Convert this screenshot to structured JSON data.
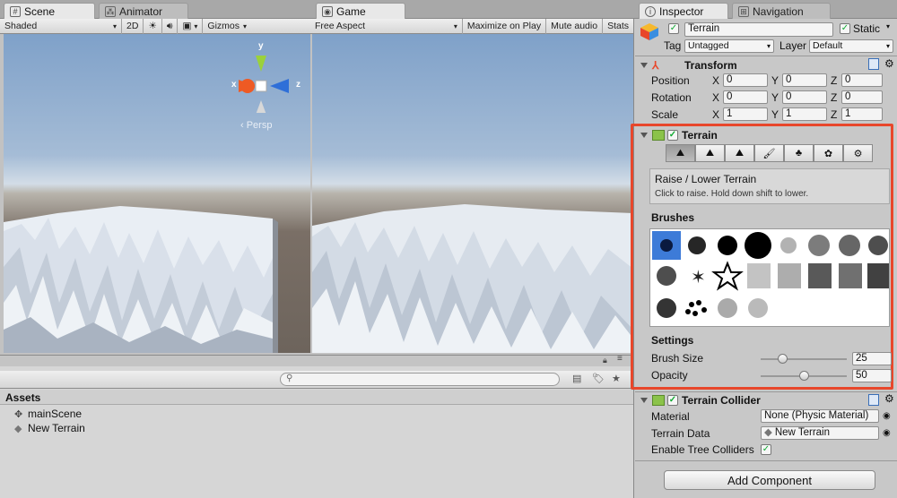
{
  "scene_panel": {
    "tabs": [
      {
        "label": "Scene",
        "icon": "hash-icon"
      },
      {
        "label": "Animator",
        "icon": "animator-icon"
      }
    ],
    "toolbar": {
      "shading": "Shaded",
      "mode_2d": "2D",
      "gizmos": "Gizmos"
    },
    "gizmo": {
      "y": "y",
      "x": "x",
      "z": "z",
      "projection": "‹ Persp"
    }
  },
  "game_panel": {
    "tab": "Game",
    "toolbar": {
      "aspect": "Free Aspect",
      "maximize": "Maximize on Play",
      "mute": "Mute audio",
      "stats": "Stats"
    }
  },
  "project_panel": {
    "assets_header": "Assets",
    "items": [
      {
        "label": "mainScene",
        "icon": "unity-scene-icon"
      },
      {
        "label": "New Terrain",
        "icon": "terrain-asset-icon"
      }
    ]
  },
  "inspector": {
    "tabs": [
      {
        "label": "Inspector",
        "icon": "info-icon"
      },
      {
        "label": "Navigation",
        "icon": "navigation-icon"
      }
    ],
    "object_name": "Terrain",
    "static_label": "Static",
    "tag_label": "Tag",
    "tag_value": "Untagged",
    "layer_label": "Layer",
    "layer_value": "Default",
    "transform": {
      "title": "Transform",
      "rows": [
        {
          "label": "Position",
          "x": "0",
          "y": "0",
          "z": "0"
        },
        {
          "label": "Rotation",
          "x": "0",
          "y": "0",
          "z": "0"
        },
        {
          "label": "Scale",
          "x": "1",
          "y": "1",
          "z": "1"
        }
      ]
    },
    "terrain": {
      "title": "Terrain",
      "tool_title": "Raise / Lower Terrain",
      "tool_help": "Click to raise. Hold down shift to lower.",
      "brushes_label": "Brushes",
      "settings_label": "Settings",
      "brush_size_label": "Brush Size",
      "brush_size_value": "25",
      "brush_size_fraction": 0.25,
      "opacity_label": "Opacity",
      "opacity_value": "50",
      "opacity_fraction": 0.5
    },
    "collider": {
      "title": "Terrain Collider",
      "material_label": "Material",
      "material_value": "None (Physic Material)",
      "data_label": "Terrain Data",
      "data_value": "New Terrain",
      "trees_label": "Enable Tree Colliders"
    },
    "add_component": "Add Component"
  },
  "colors": {
    "highlight": "#e8472b",
    "accent": "#2f6fd8"
  }
}
